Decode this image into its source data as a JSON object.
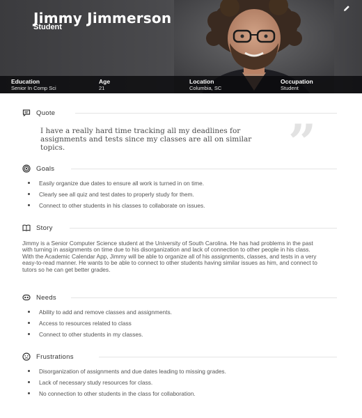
{
  "persona": {
    "name": "Jimmy Jimmerson",
    "role": "Student",
    "stats": [
      {
        "label": "Education",
        "value": "Senior In Comp Sci"
      },
      {
        "label": "Age",
        "value": "21"
      },
      {
        "label": "Location",
        "value": "Columbia, SC"
      },
      {
        "label": "Occupation",
        "value": "Student"
      }
    ]
  },
  "sections": {
    "quote": {
      "title": "Quote",
      "text": "I have a really hard time tracking all my deadlines for assignments and tests since my classes are all on similar topics.",
      "mark": "”"
    },
    "goals": {
      "title": "Goals",
      "items": [
        "Easily organize due dates to ensure all work is turned in on time.",
        "Clearly see all quiz and test dates to properly study for them.",
        "Connect to other students in his classes to collaborate on issues."
      ]
    },
    "story": {
      "title": "Story",
      "text": "Jimmy is a Senior Computer Science student at the University of South Carolina. He has had problems in the past with turning in assignments on time due to his disorganization and lack of connection to other people in his class. With the Academic Calendar App, Jimmy will be able to organize all of his assignments, classes, and tests in a very easy-to-read manner. He wants to be able to connect to other students having similar issues as him, and connect to tutors so he can get better grades."
    },
    "needs": {
      "title": "Needs",
      "items": [
        "Ability to add and remove classes and assignments.",
        "Access to resources related to class",
        "Connect to other students in my classes."
      ]
    },
    "frustrations": {
      "title": "Frustrations",
      "items": [
        "Disorganization of assignments and due dates leading to missing grades.",
        "Lack of necessary study resources for class.",
        "No connection to other students in the class for collaboration."
      ]
    }
  },
  "icons": {
    "quote": "chat-icon",
    "goals": "target-icon",
    "story": "book-icon",
    "needs": "needs-icon",
    "frustrations": "frown-icon",
    "edit": "pencil-icon"
  },
  "colors": {
    "header_bg": "#48484b",
    "stats_bar": "#0a0a0c",
    "text": "#555555",
    "quote_mark": "#e2e2e2"
  }
}
